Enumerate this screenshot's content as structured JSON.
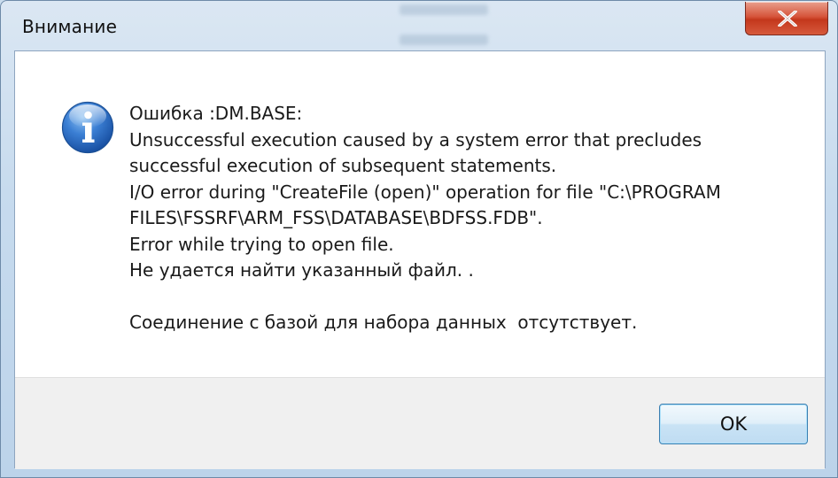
{
  "window": {
    "title": "Внимание",
    "close_icon": "close-icon"
  },
  "dialog": {
    "icon": "info-icon",
    "lines": [
      "Ошибка :DM.BASE:",
      "Unsuccessful execution caused by a system error that precludes",
      "successful execution of subsequent statements.",
      "I/O error during \"CreateFile (open)\" operation for file \"C:\\PROGRAM",
      "FILES\\FSSRF\\ARM_FSS\\DATABASE\\BDFSS.FDB\".",
      "Error while trying to open file.",
      "Не удается найти указанный файл. .",
      "",
      "Соединение с базой для набора данных  отсутствует."
    ],
    "ok_label": "OK"
  },
  "colors": {
    "close_button": "#c4371c",
    "ok_border": "#3c7fb1",
    "info_icon": "#1f5fb5"
  }
}
